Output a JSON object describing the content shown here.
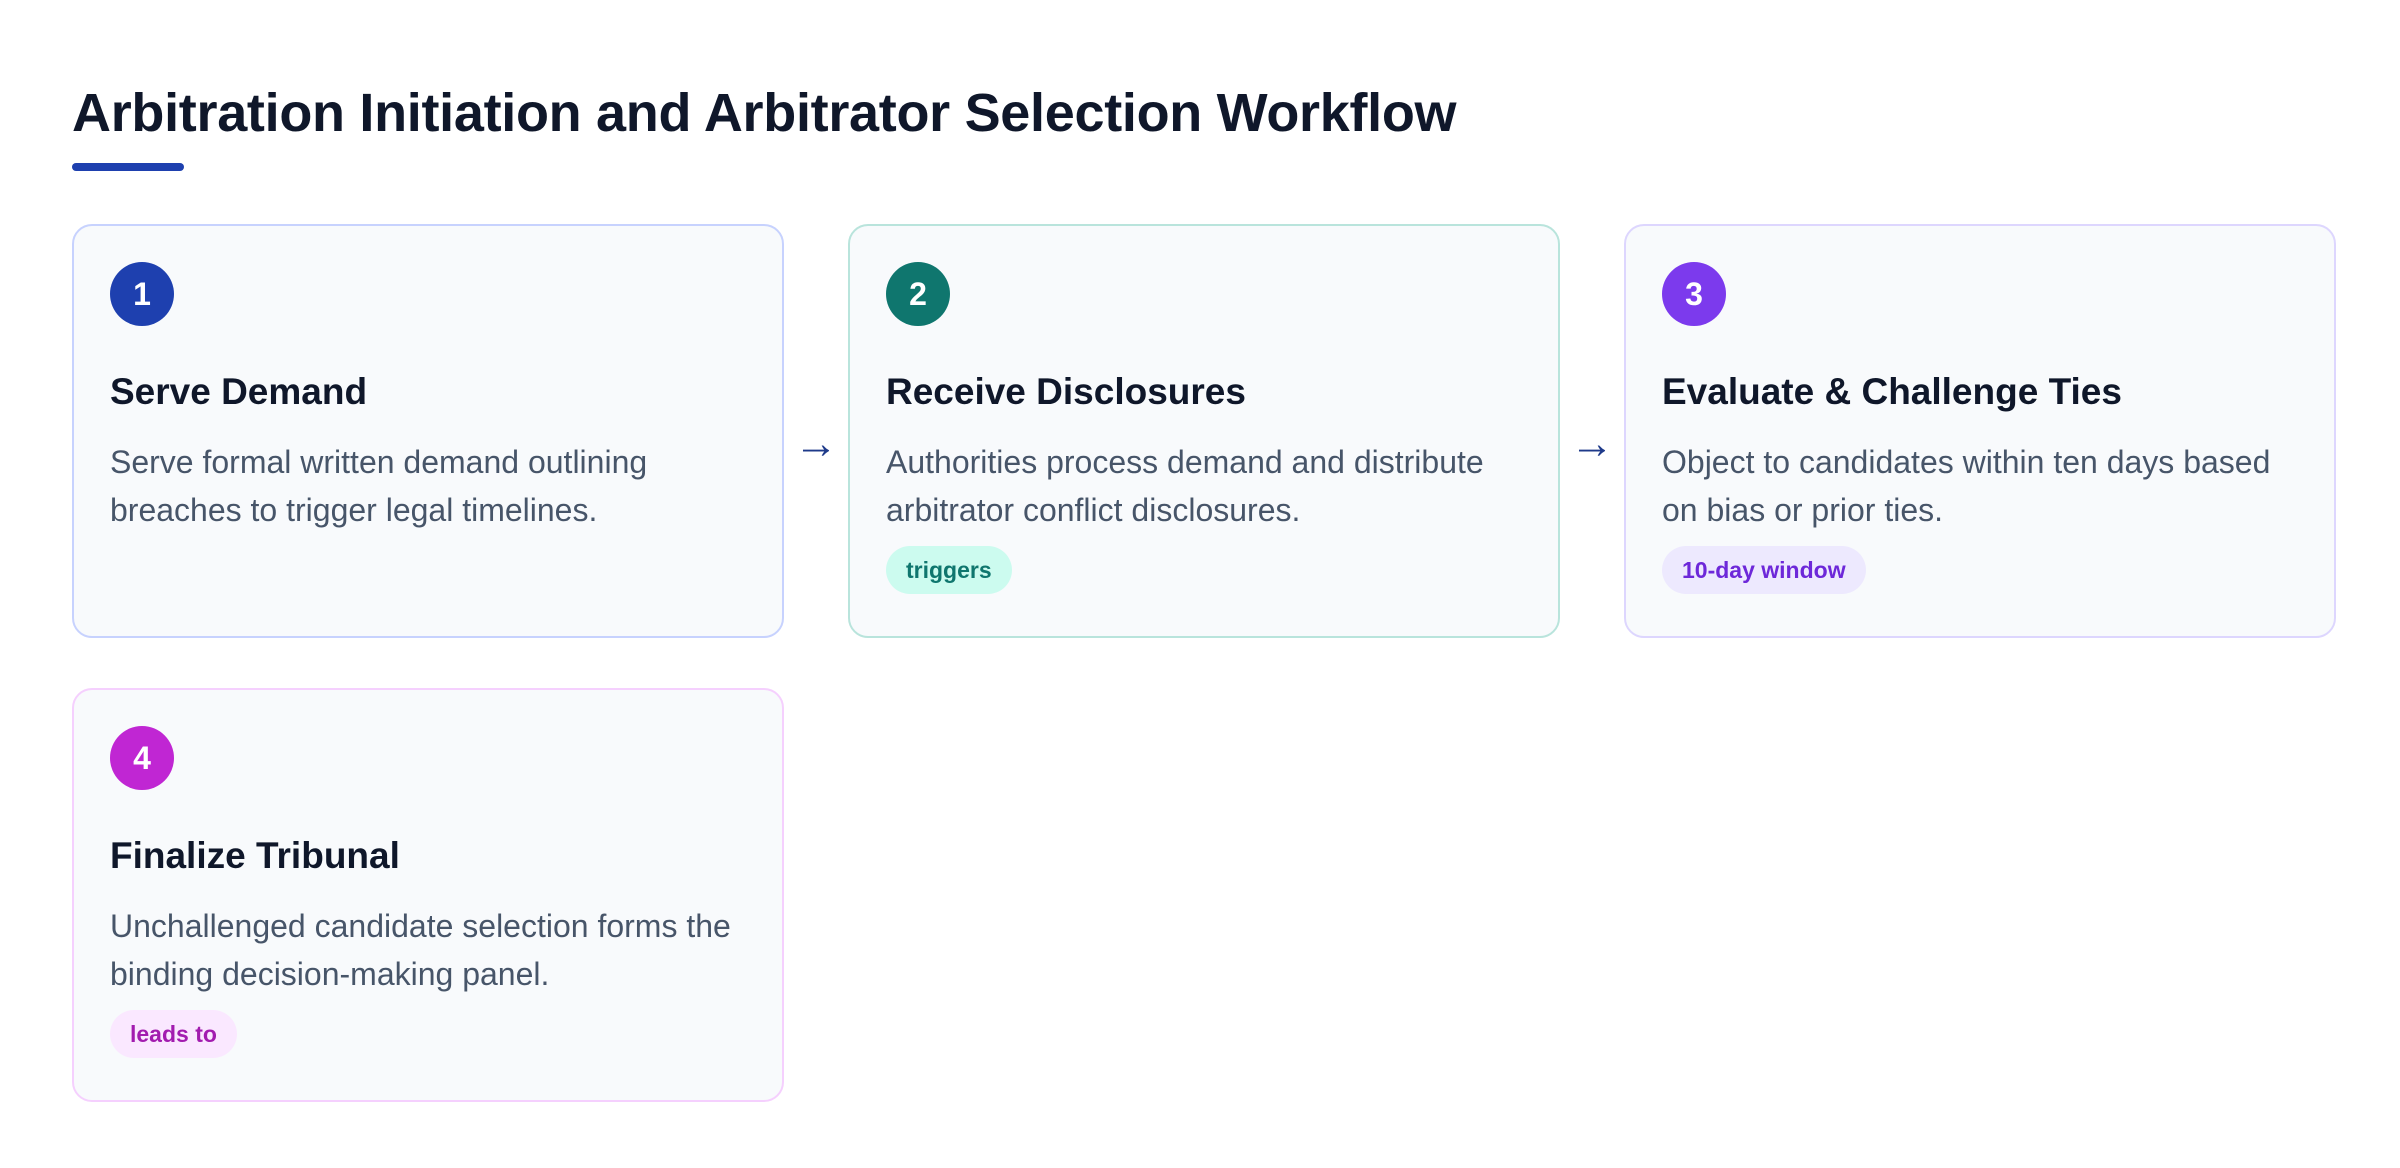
{
  "title": "Arbitration Initiation and Arbitrator Selection Workflow",
  "arrow_glyph": "→",
  "steps": [
    {
      "number": "1",
      "title": "Serve Demand",
      "description": "Serve formal written demand outlining breaches to trigger legal timelines.",
      "tag": "",
      "color": "#1e40af",
      "border": "#c7d2fe",
      "tag_bg": "",
      "tag_fg": ""
    },
    {
      "number": "2",
      "title": "Receive Disclosures",
      "description": "Authorities process demand and distribute arbitrator conflict disclosures.",
      "tag": "triggers",
      "color": "#0f766e",
      "border": "#b9e4dc",
      "tag_bg": "#ccfbef",
      "tag_fg": "#0f766e"
    },
    {
      "number": "3",
      "title": "Evaluate & Challenge Ties",
      "description": "Object to candidates within ten days based on bias or prior ties.",
      "tag": "10-day window",
      "color": "#7c3aed",
      "border": "#ddd6fe",
      "tag_bg": "#ede9fe",
      "tag_fg": "#6d28d9"
    },
    {
      "number": "4",
      "title": "Finalize Tribunal",
      "description": "Unchallenged candidate selection forms the binding decision-making panel.",
      "tag": "leads to",
      "color": "#c026d3",
      "border": "#f5d0fe",
      "tag_bg": "#fae8ff",
      "tag_fg": "#a21caf"
    }
  ]
}
